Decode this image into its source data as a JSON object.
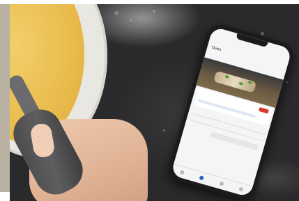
{
  "scene": {
    "description_items": [
      "mixing-bowl",
      "whisk-handle",
      "hand",
      "smartphone",
      "dark-stone-countertop"
    ]
  },
  "colors": {
    "countertop": "#2b2b2d",
    "batter": "#e8b94a",
    "bowl": "#e9e7e2",
    "whisk_handle": "#4a4a4c",
    "skin": "#e0b294",
    "phone_body": "#1b1b1d",
    "app_accent": "#2a63b9",
    "app_badge": "#d73a2e"
  },
  "phone": {
    "screen": {
      "title": "Oven"
    }
  }
}
